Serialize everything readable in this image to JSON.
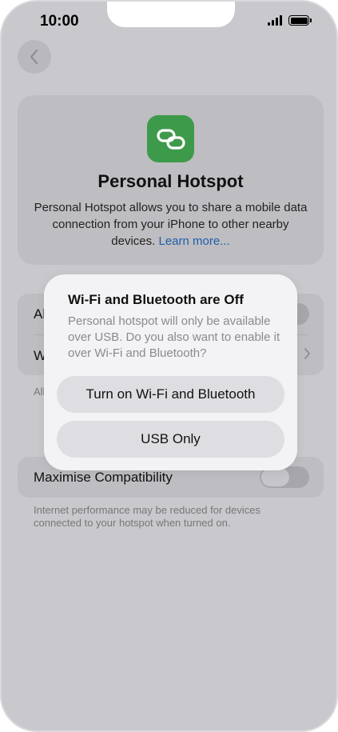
{
  "status_bar": {
    "time": "10:00"
  },
  "hero": {
    "title": "Personal Hotspot",
    "description": "Personal Hotspot allows you to share a mobile data connection from your iPhone to other nearby devices.",
    "learn_more": "Learn more..."
  },
  "settings": {
    "allow_others_partial": "Al",
    "wifi_password_partial": "W",
    "allow_footnote_partial": "Allo",
    "maximise_compatibility": {
      "label": "Maximise Compatibility",
      "enabled": false,
      "footnote": "Internet performance may be reduced for devices connected to your hotspot when turned on."
    }
  },
  "dialog": {
    "title": "Wi-Fi and Bluetooth are Off",
    "message": "Personal hotspot will only be available over USB. Do you also want to enable it over Wi-Fi and Bluetooth?",
    "primary_button": "Turn on Wi-Fi and Bluetooth",
    "secondary_button": "USB Only"
  },
  "icons": {
    "back": "chevron-left-icon",
    "hotspot": "link-chain-icon",
    "signal": "cellular-signal-icon",
    "battery": "battery-icon",
    "chevron": "chevron-right-icon"
  },
  "colors": {
    "hotspot_icon_bg": "#3e9a4b",
    "link": "#1f5fa8",
    "overlay_bg": "#c9c8cd"
  }
}
